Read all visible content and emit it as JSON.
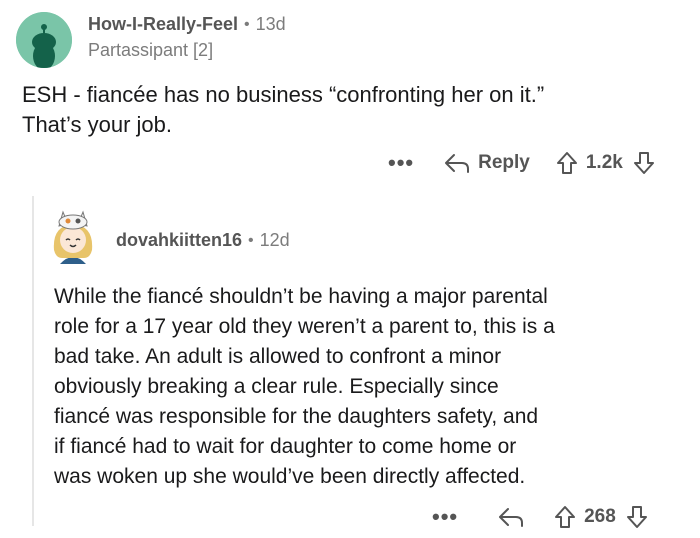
{
  "comment1": {
    "username": "How-I-Really-Feel",
    "separator": "•",
    "age": "13d",
    "flair": "Partassipant [2]",
    "body_lines": [
      "ESH - fiancée has no business “confronting her on it.”",
      "That’s your job."
    ],
    "more": "•••",
    "reply_label": "Reply",
    "score": "1.2k"
  },
  "comment2": {
    "username": "dovahkiitten16",
    "separator": "•",
    "age": "12d",
    "body_lines": [
      "While the fiancé shouldn’t be having a major parental",
      "role for a 17 year old they weren’t a parent to, this is a",
      "bad take. An adult is allowed to confront a minor",
      "obviously breaking a clear rule. Especially since",
      "fiancé was responsible for the daughters safety, and",
      "if fiancé had to wait for daughter to come home or",
      "was woken up she would’ve been directly affected."
    ],
    "more": "•••",
    "score": "268"
  },
  "colors": {
    "avatar1_bg": "#7ac5a8",
    "text": "#1a1a1b",
    "meta": "#7c7c7c",
    "thread_line": "#e6e6e6"
  }
}
